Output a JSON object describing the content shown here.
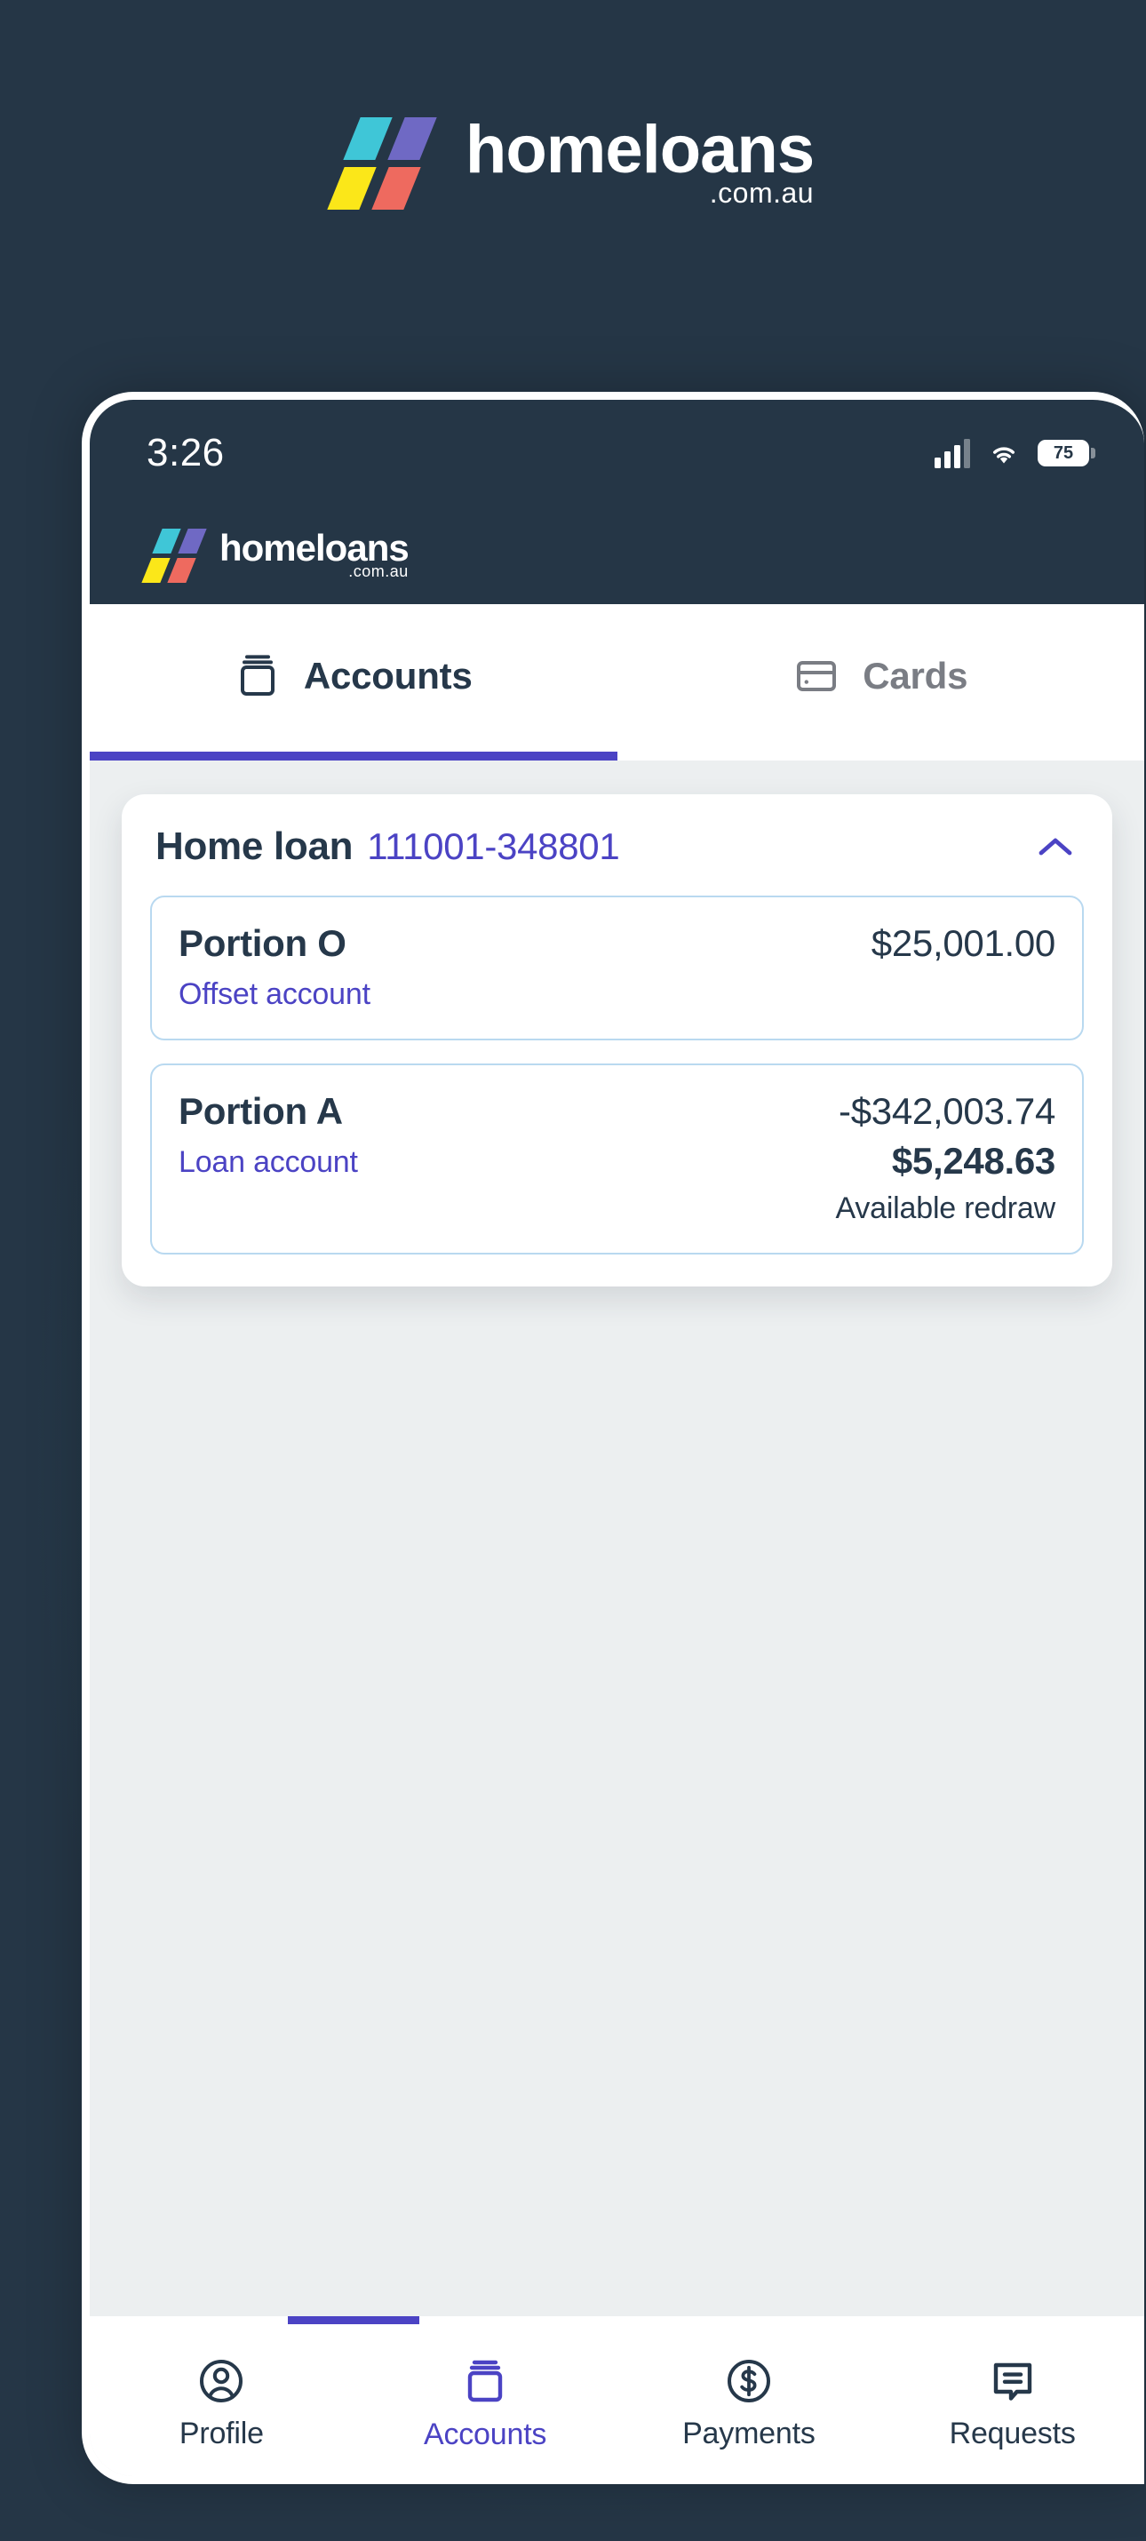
{
  "brand": {
    "word": "homeloans",
    "tld": ".com.au",
    "logo_colors": {
      "teal": "#3fc6d7",
      "purple": "#6f69c4",
      "yellow": "#fbe719",
      "red": "#ee6a5f"
    },
    "background_color": "#253646"
  },
  "status_bar": {
    "time": "3:26",
    "signal_icon": "cellular-signal-icon",
    "wifi_icon": "wifi-icon",
    "battery_level": "75"
  },
  "app_header": {
    "word": "homeloans",
    "tld": ".com.au"
  },
  "tabs": {
    "accent_color": "#4b43c4",
    "items": [
      {
        "label": "Accounts",
        "icon": "jar-icon",
        "active": true
      },
      {
        "label": "Cards",
        "icon": "credit-card-icon",
        "active": false
      }
    ]
  },
  "account_card": {
    "title": "Home loan",
    "number": "111001-348801",
    "collapse_icon": "chevron-up-icon",
    "portions": [
      {
        "name": "Portion O",
        "type": "Offset account",
        "amount_primary": "$25,001.00",
        "amount_secondary": "",
        "amount_caption": ""
      },
      {
        "name": "Portion A",
        "type": "Loan account",
        "amount_primary": "-$342,003.74",
        "amount_secondary": "$5,248.63",
        "amount_caption": "Available redraw"
      }
    ]
  },
  "bottom_nav": {
    "active_color": "#4b43c4",
    "items": [
      {
        "label": "Profile",
        "icon": "user-circle-icon",
        "active": false
      },
      {
        "label": "Accounts",
        "icon": "jar-icon",
        "active": true
      },
      {
        "label": "Payments",
        "icon": "dollar-circle-icon",
        "active": false
      },
      {
        "label": "Requests",
        "icon": "message-icon",
        "active": false
      }
    ]
  }
}
